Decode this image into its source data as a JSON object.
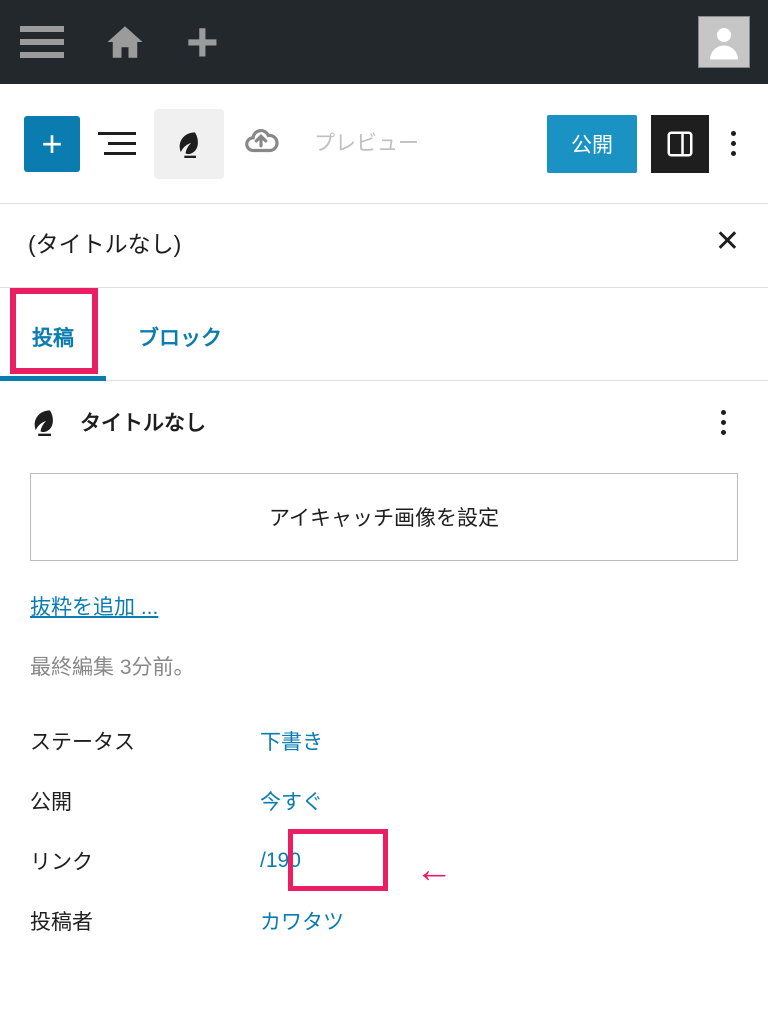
{
  "adminBar": {},
  "editorToolbar": {
    "preview": "プレビュー",
    "publish": "公開"
  },
  "titleRow": {
    "title": "(タイトルなし)"
  },
  "tabs": {
    "post": "投稿",
    "block": "ブロック"
  },
  "panel": {
    "title": "タイトルなし",
    "featuredImage": "アイキャッチ画像を設定",
    "addExcerpt": "抜粋を追加 ...",
    "lastEdited": "最終編集 3分前。",
    "rows": [
      {
        "label": "ステータス",
        "value": "下書き"
      },
      {
        "label": "公開",
        "value": "今すぐ"
      },
      {
        "label": "リンク",
        "value": "/190"
      },
      {
        "label": "投稿者",
        "value": "カワタツ"
      }
    ]
  }
}
